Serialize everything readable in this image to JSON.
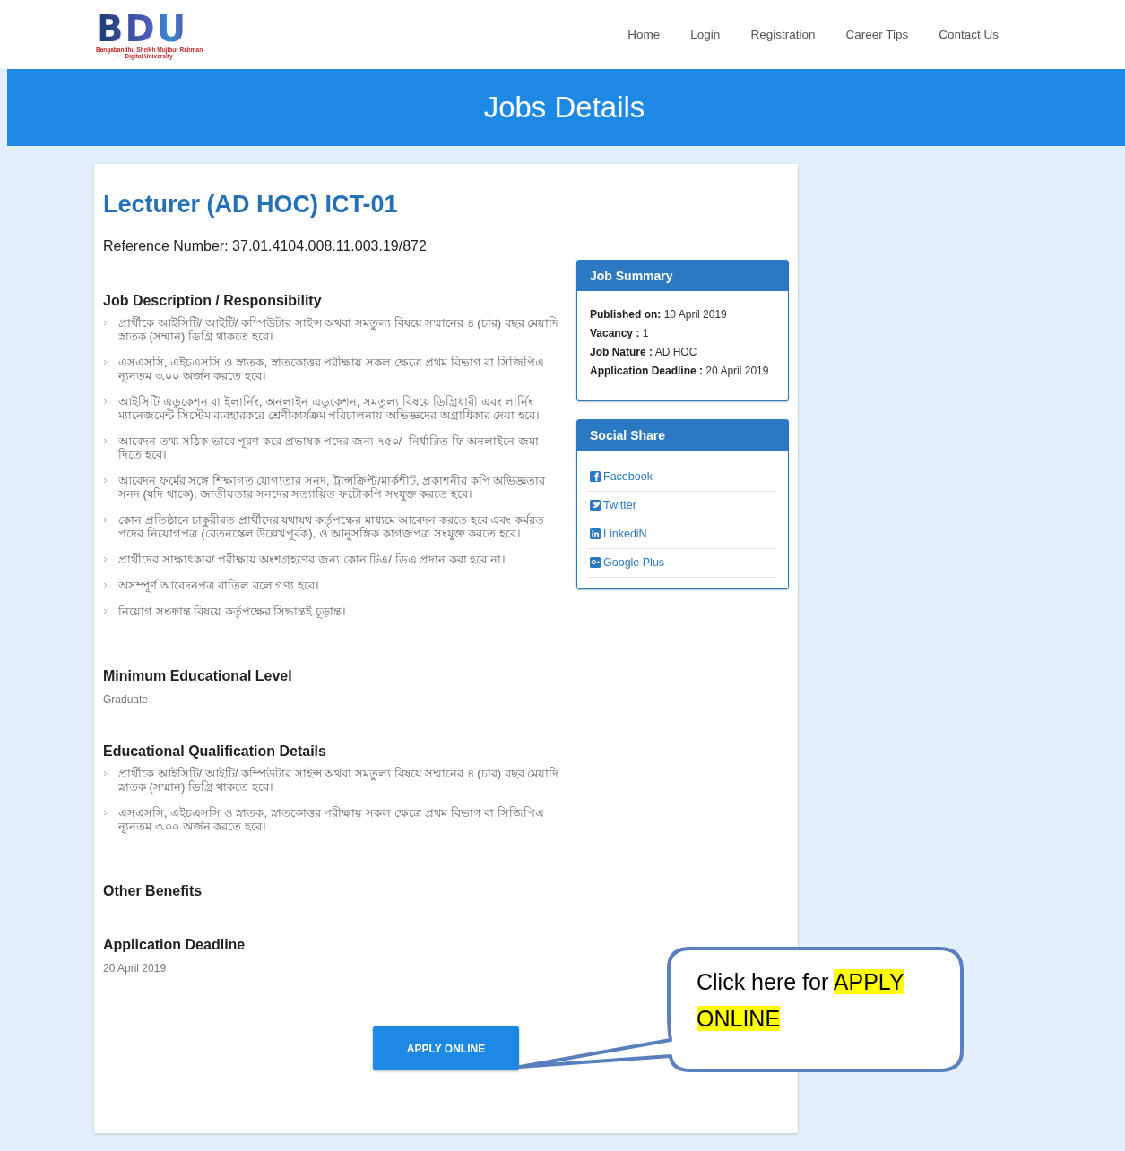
{
  "header": {
    "logo": {
      "mark": "BDU",
      "name_lines": [
        "Bangabandhu Sheikh Mujibur Rahman",
        "Digital University"
      ]
    },
    "nav": [
      {
        "label": "Home"
      },
      {
        "label": "Login"
      },
      {
        "label": "Registration"
      },
      {
        "label": "Career Tips"
      },
      {
        "label": "Contact Us"
      }
    ]
  },
  "banner": {
    "title": "Jobs Details"
  },
  "job": {
    "title": "Lecturer (AD HOC) ICT-01",
    "reference_label": "Reference Number:",
    "reference": "37.01.4104.008.11.003.19/872",
    "sections": [
      {
        "kind": "list",
        "heading": "Job Description / Responsibility",
        "items": [
          "প্রার্থীকে আইসিটি/ আইটি/ কম্পিউটার সাইন্স অথবা সমতুল্য বিষয়ে সম্মানের ৪ (চার) বছর মেয়াদি স্নাতক (সম্মান) ডিগ্রি থাকতে হবে।",
          "এসএসসি, এইচএসসি ও স্নাতক, স্নাতকোত্তর পরীক্ষায় সকল ক্ষেত্রে প্রথম বিভাগ বা সিজিপিএ ন্যূনতম ৩.০০ অর্জন করতে হবে।",
          "আইসিটি এডুকেশন বা ইলার্নিং, অনলাইন এডুকেশন, সমতুল্য বিষয়ে ডিগ্রিধারী এবং লার্নিং ম্যানেজমেন্ট সিস্টেম ব্যবহারকরে শ্রেণীকার্যক্রম পরিচালনায় অভিজ্ঞদের অগ্রাধিকার দেয়া হবে।",
          "আবেদন তথ্য সঠিক ভাবে পূরণ করে প্রভাষক পদের জন্য ৭৫০/- নির্ধারিত ফি অনলাইনে জমা দিতে হবে।",
          "আবেদন ফর্মের সঙ্গে শিক্ষাগত যোগ্যতার সনদ, ট্রান্সক্রিপ্ট/মার্কশীট, প্রকাশনীর কপি অভিজ্ঞতার সনদ (যদি থাকে), জাতীয়তার সনদের সত্যায়িত ফটোকপি সংযুক্ত করতে হবে।",
          "কোন প্রতিষ্ঠানে চাকুরীরত প্রার্থীদের যথাযথ কর্তৃপক্ষের মাধ্যমে আবেদন করতে হবে এবং কর্মরত পদের নিয়োগপত্র (বেতনস্কেল উল্লেখপূর্বক), ও আনুসঙ্গিক কাগজপত্র সংযুক্ত করতে হবে।",
          "প্রার্থীদের সাক্ষাৎকার/ পরীক্ষায় অংশগ্রহণের জন্য কোন টিএ/ ডিএ প্রদান করা হবে না।",
          "অসম্পূর্ণ আবেদনপত্র বাতিল বলে গণ্য হবে।",
          "নিয়োগ সংক্রান্ত বিষয়ে কর্তৃপক্ষের সিদ্ধান্তই চূড়ান্ত।"
        ]
      },
      {
        "kind": "text",
        "heading": "Minimum Educational Level",
        "text": "Graduate"
      },
      {
        "kind": "list",
        "heading": "Educational Qualification Details",
        "items": [
          "প্রার্থীকে আইসিটি/ আইটি/ কম্পিউটার সাইন্স অথবা সমতুল্য বিষয়ে সম্মানের ৪ (চার) বছর মেয়াদি স্নাতক (সম্মান) ডিগ্রি থাকতে হবে।",
          "এসএসসি, এইচএসসি ও স্নাতক, স্নাতকোত্তর পরীক্ষায় সকল ক্ষেত্রে প্রথম বিভাগ বা সিজিপিএ ন্যূনতম ৩.০০ অর্জন করতে হবে।"
        ]
      },
      {
        "kind": "heading",
        "heading": "Other Benefits"
      },
      {
        "kind": "text",
        "heading": "Application Deadline",
        "text": "20 April 2019"
      }
    ],
    "apply_button": "APPLY ONLINE"
  },
  "summary": {
    "title": "Job Summary",
    "rows": [
      {
        "label": "Published on:",
        "value": "10 April 2019"
      },
      {
        "label": "Vacancy :",
        "value": "1"
      },
      {
        "label": "Job Nature :",
        "value": "AD HOC"
      },
      {
        "label": "Application Deadline :",
        "value": "20 April 2019"
      }
    ]
  },
  "social": {
    "title": "Social Share",
    "links": [
      {
        "kind": "facebook",
        "label": "Facebook"
      },
      {
        "kind": "twitter",
        "label": "Twitter"
      },
      {
        "kind": "linkedin",
        "label": "LinkediN"
      },
      {
        "kind": "googleplus",
        "label": "Google Plus"
      }
    ]
  },
  "callout": {
    "text": "Click here for",
    "highlight": "APPLY ONLINE"
  }
}
